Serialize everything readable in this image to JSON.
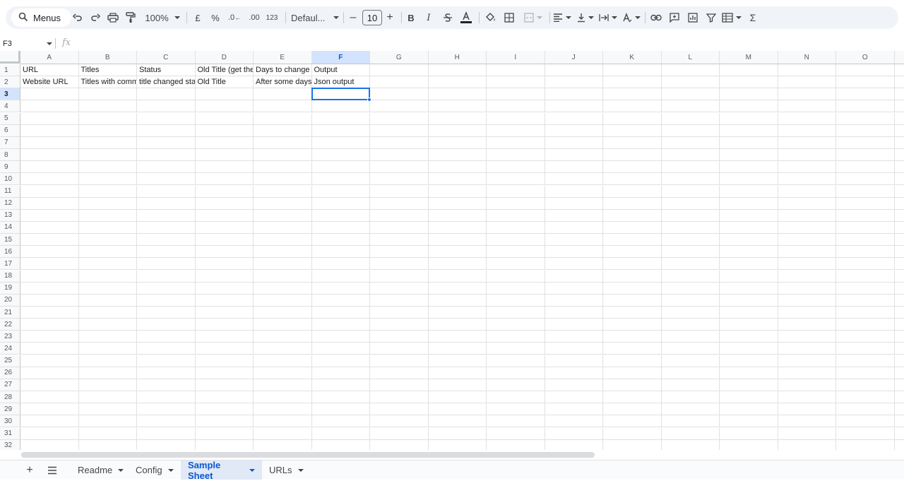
{
  "toolbar": {
    "menus_label": "Menus",
    "zoom": "100%",
    "currency": "£",
    "percent": "%",
    "decrease_decimal": ".0",
    "increase_decimal": ".00",
    "number_format": "123",
    "font": "Defaul...",
    "font_size": "10",
    "bold": "B",
    "italic": "I",
    "sum": "Σ"
  },
  "formula_bar": {
    "cell_ref": "F3",
    "fx": "fx"
  },
  "columns": [
    "A",
    "B",
    "C",
    "D",
    "E",
    "F",
    "G",
    "H",
    "I",
    "J",
    "K",
    "L",
    "M",
    "N",
    "O"
  ],
  "selected_column": "F",
  "rows": [
    "1",
    "2",
    "3",
    "4",
    "5",
    "6",
    "7",
    "8",
    "9",
    "10",
    "11",
    "12",
    "13",
    "14",
    "15",
    "16",
    "17",
    "18",
    "19",
    "20",
    "21",
    "22",
    "23",
    "24",
    "25",
    "26",
    "27",
    "28",
    "29",
    "30",
    "31",
    "32"
  ],
  "selected_row": "3",
  "data": {
    "r1": [
      "URL",
      "Titles",
      "Status",
      "Old Title (get the",
      "Days to change",
      "Output"
    ],
    "r2": [
      "Website URL",
      "Titles with comm",
      "title changed sta",
      "Old Title",
      "After some days",
      "Json output"
    ]
  },
  "sheets": [
    {
      "label": "Readme",
      "active": false
    },
    {
      "label": "Config",
      "active": false
    },
    {
      "label": "Sample Sheet",
      "active": true
    },
    {
      "label": "URLs",
      "active": false
    }
  ],
  "colors": {
    "accent": "#1a73e8",
    "selected_header": "#d3e3fd",
    "active_tab": "#0b57d0"
  }
}
